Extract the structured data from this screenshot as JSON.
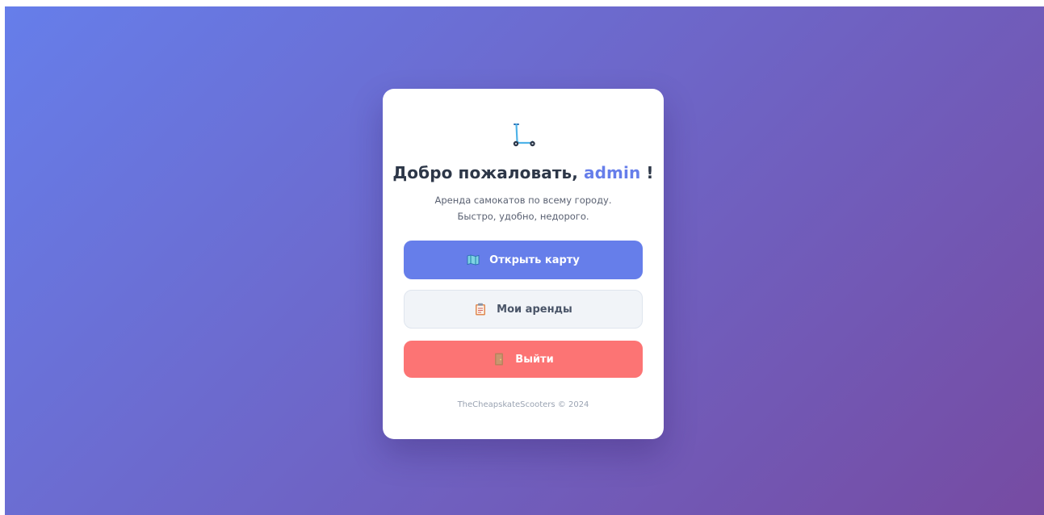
{
  "card": {
    "icon": "kick-scooter-icon",
    "title_prefix": "Добро пожаловать,",
    "username": "admin",
    "title_suffix": "!",
    "subtitle_line1": "Аренда самокатов по всему городу.",
    "subtitle_line2": "Быстро, удобно, недорого."
  },
  "buttons": {
    "open_map": {
      "icon": "map-icon",
      "label": "Открыть карту"
    },
    "my_rentals": {
      "icon": "clipboard-icon",
      "label": "Мои аренды"
    },
    "logout": {
      "icon": "door-icon",
      "label": "Выйти"
    }
  },
  "footer": {
    "text": "TheCheapskateScooters © 2024"
  },
  "colors": {
    "gradient_start": "#667eea",
    "gradient_end": "#764ba2",
    "accent": "#667eea",
    "danger": "#fc7474"
  }
}
